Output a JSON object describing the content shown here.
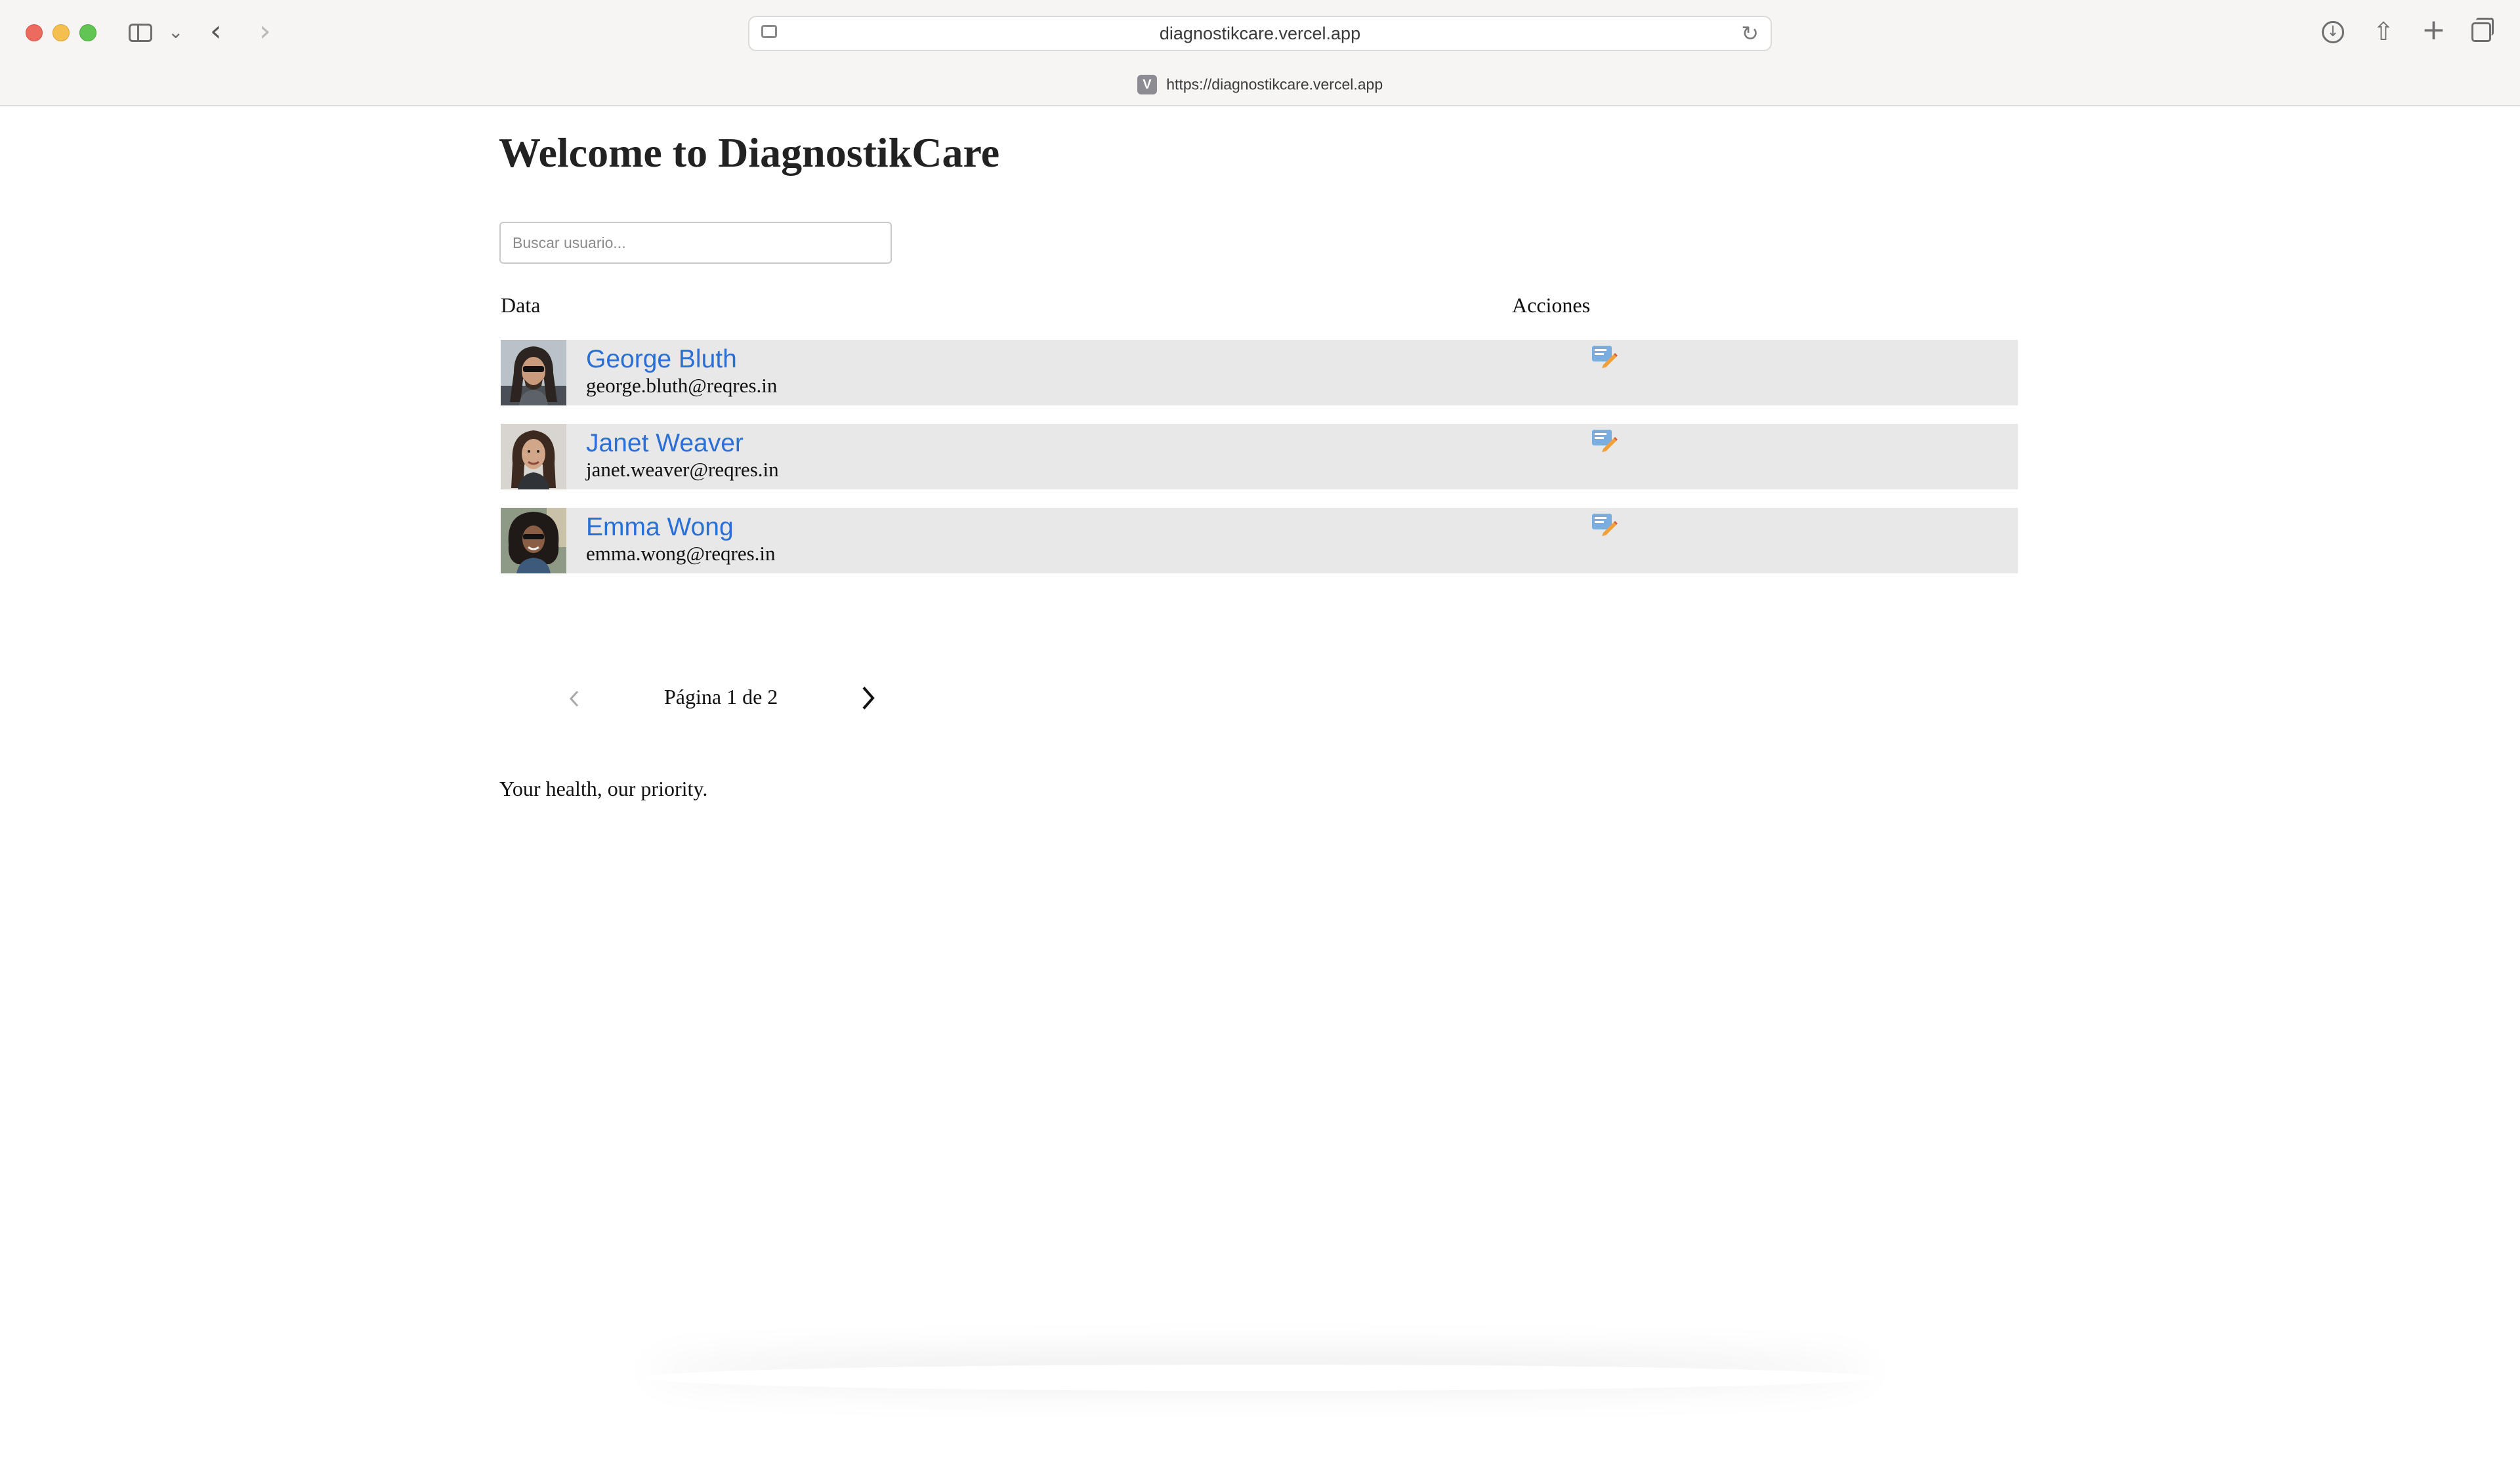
{
  "browser": {
    "address_bar_host": "diagnostikcare.vercel.app",
    "favicon_letter": "V",
    "url_strip_text": "https://diagnostikcare.vercel.app"
  },
  "page": {
    "title": "Welcome to DiagnostikCare",
    "search": {
      "placeholder": "Buscar usuario...",
      "value": ""
    },
    "table": {
      "columns": [
        "Data",
        "Acciones"
      ],
      "rows": [
        {
          "name": "George Bluth",
          "email": "george.bluth@reqres.in"
        },
        {
          "name": "Janet Weaver",
          "email": "janet.weaver@reqres.in"
        },
        {
          "name": "Emma Wong",
          "email": "emma.wong@reqres.in"
        }
      ]
    },
    "pagination": {
      "label": "Página 1 de 2",
      "current_page": 1,
      "total_pages": 2,
      "prev_enabled": false,
      "next_enabled": true
    },
    "footer": "Your health, our priority."
  },
  "icons": {
    "sidebar": "sidebar-icon",
    "back": "back-arrow-icon",
    "forward": "forward-arrow-icon",
    "reload": "reload-icon",
    "download": "download-icon",
    "share": "share-icon",
    "new_tab": "plus-icon",
    "tabs": "tab-overview-icon",
    "edit": "edit-icon"
  },
  "colors": {
    "link": "#2a6fd6",
    "row_background": "#e8e8e8",
    "edit_icon": "#7aaee0"
  }
}
